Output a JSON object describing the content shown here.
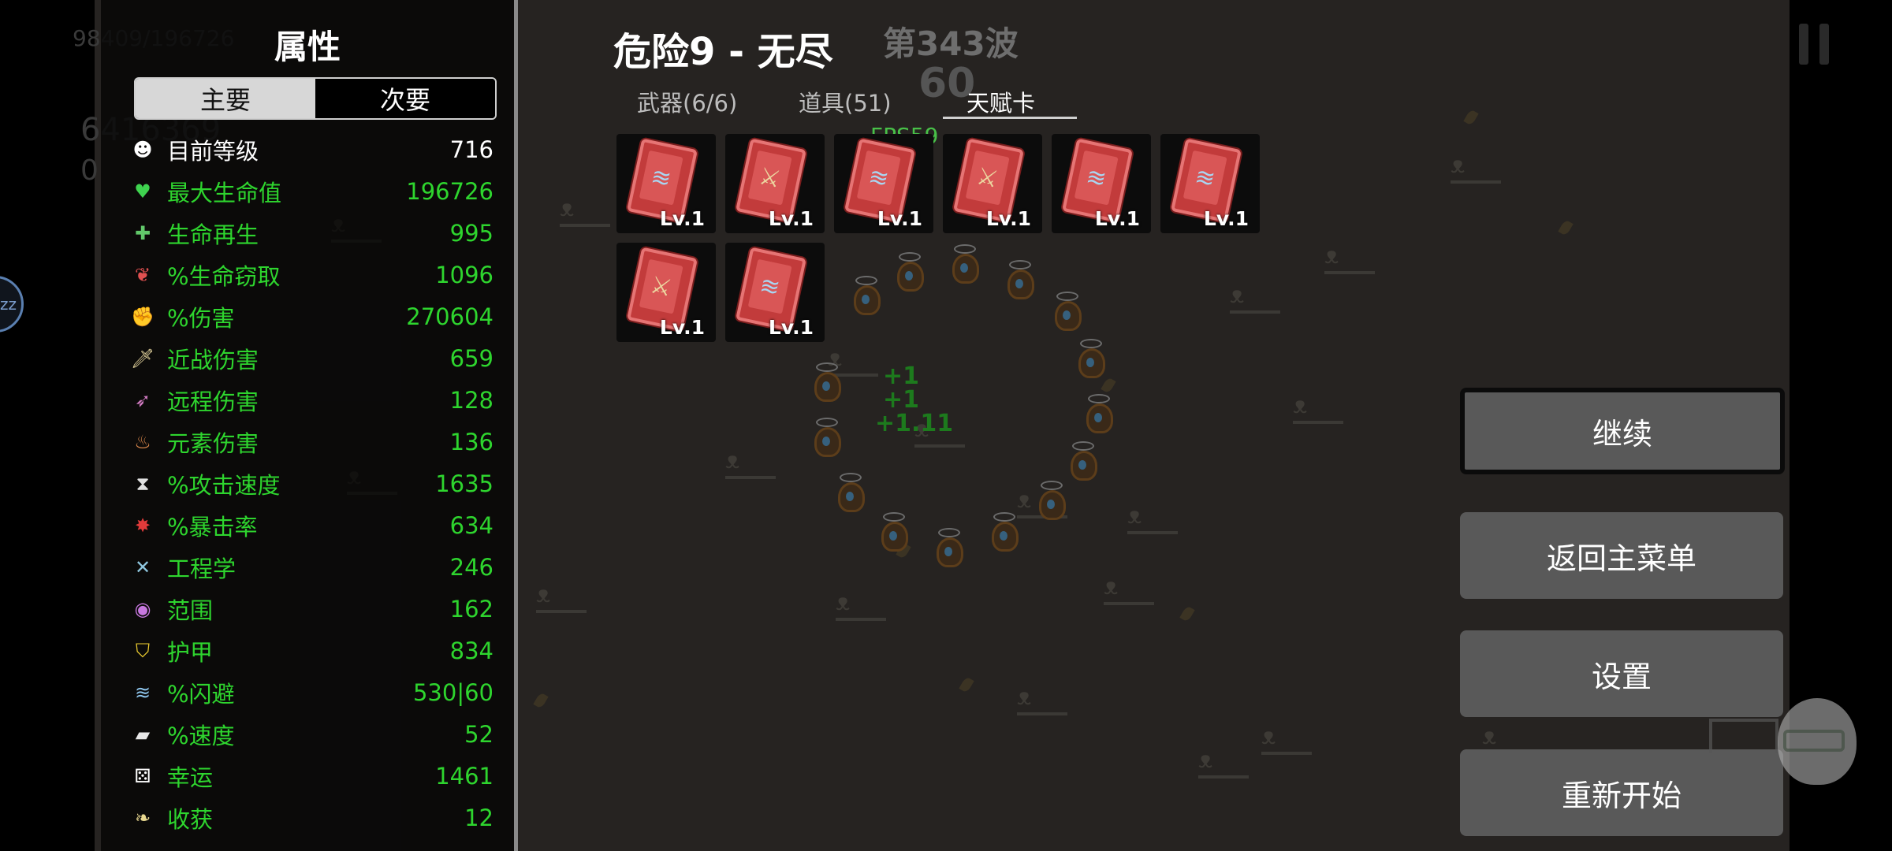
{
  "stats_panel": {
    "title": "属性",
    "tabs": [
      {
        "label": "主要"
      },
      {
        "label": "次要"
      }
    ],
    "active_tab": "主要",
    "stats": [
      {
        "icon": "level-icon",
        "glyph": "☻",
        "label": "目前等级",
        "value": "716",
        "color": "white"
      },
      {
        "icon": "heart-icon",
        "glyph": "♥",
        "label": "最大生命值",
        "value": "196726",
        "color": "green"
      },
      {
        "icon": "regen-icon",
        "glyph": "✚",
        "label": "生命再生",
        "value": "995",
        "color": "green"
      },
      {
        "icon": "lifesteal-icon",
        "glyph": "❦",
        "label": "%生命窃取",
        "value": "1096",
        "color": "green"
      },
      {
        "icon": "damage-icon",
        "glyph": "✊",
        "label": "%伤害",
        "value": "270604",
        "color": "green"
      },
      {
        "icon": "sword-icon",
        "glyph": "🗡",
        "label": "近战伤害",
        "value": "659",
        "color": "green"
      },
      {
        "icon": "bow-icon",
        "glyph": "➶",
        "label": "远程伤害",
        "value": "128",
        "color": "green"
      },
      {
        "icon": "flame-icon",
        "glyph": "♨",
        "label": "元素伤害",
        "value": "136",
        "color": "green"
      },
      {
        "icon": "hourglass-icon",
        "glyph": "⧗",
        "label": "%攻击速度",
        "value": "1635",
        "color": "green"
      },
      {
        "icon": "crit-icon",
        "glyph": "✸",
        "label": "%暴击率",
        "value": "634",
        "color": "green"
      },
      {
        "icon": "wrench-icon",
        "glyph": "✕",
        "label": "工程学",
        "value": "246",
        "color": "green"
      },
      {
        "icon": "range-icon",
        "glyph": "◉",
        "label": "范围",
        "value": "162",
        "color": "green"
      },
      {
        "icon": "shield-icon",
        "glyph": "⛉",
        "label": "护甲",
        "value": "834",
        "color": "green"
      },
      {
        "icon": "dodge-icon",
        "glyph": "≋",
        "label": "%闪避",
        "value": "530|60",
        "color": "green"
      },
      {
        "icon": "boot-icon",
        "glyph": "▰",
        "label": "%速度",
        "value": "52",
        "color": "green"
      },
      {
        "icon": "dice-icon",
        "glyph": "⚄",
        "label": "幸运",
        "value": "1461",
        "color": "green"
      },
      {
        "icon": "harvest-icon",
        "glyph": "❧",
        "label": "收获",
        "value": "12",
        "color": "green"
      }
    ]
  },
  "background_hud": {
    "hp_text": "98409/196726",
    "materials": "6416369",
    "bag": "0"
  },
  "header": {
    "mode_title": "危险9 - 无尽",
    "wave": "第343波",
    "timer": "60"
  },
  "tabs": [
    {
      "label": "武器(6/6)"
    },
    {
      "label": "道具(51)"
    },
    {
      "label": "天赋卡"
    }
  ],
  "active_tab": "天赋卡",
  "fps": "FPS59",
  "talent_cards": [
    {
      "type": "dash",
      "level": "Lv.1"
    },
    {
      "type": "sword",
      "level": "Lv.1"
    },
    {
      "type": "dash",
      "level": "Lv.1"
    },
    {
      "type": "sword",
      "level": "Lv.1"
    },
    {
      "type": "dash",
      "level": "Lv.1"
    },
    {
      "type": "dash",
      "level": "Lv.1"
    },
    {
      "type": "sword",
      "level": "Lv.1"
    },
    {
      "type": "dash",
      "level": "Lv.1"
    }
  ],
  "floating_text": [
    "+1",
    "+1",
    "+1.11"
  ],
  "menu": {
    "continue": "继续",
    "main_menu": "返回主菜单",
    "settings": "设置",
    "restart": "重新开始",
    "selected": "继续"
  },
  "edge_bubble": "zz",
  "colors": {
    "stat_green": "#2ed52e",
    "menu_button": "#595959",
    "card_red": "#c23b3b",
    "fps_green": "#48c048"
  }
}
